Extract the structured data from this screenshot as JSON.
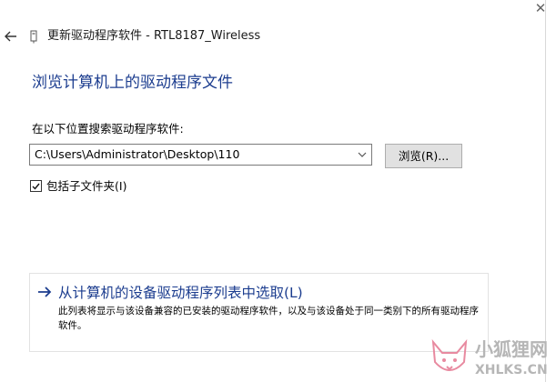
{
  "window": {
    "close_glyph": "✕",
    "title": "更新驱动程序软件 - RTL8187_Wireless",
    "back_icon": "back-arrow-icon",
    "device_icon": "device-icon"
  },
  "page": {
    "heading": "浏览计算机上的驱动程序文件",
    "search_label": "在以下位置搜索驱动程序软件:",
    "path_value": "C:\\Users\\Administrator\\Desktop\\110",
    "browse_button": "浏览(R)...",
    "include_subfolders": {
      "label": "包括子文件夹(I)",
      "checked": true
    },
    "pick_option": {
      "title": "从计算机的设备驱动程序列表中选取(L)",
      "description": "此列表将显示与该设备兼容的已安装的驱动程序软件，以及与该设备处于同一类别下的所有驱动程序软件。"
    }
  },
  "watermark": {
    "text": "小狐狸网",
    "url": "XHLKS.CN"
  },
  "colors": {
    "heading": "#1c3d8f",
    "button_bg": "#e1e1e1",
    "watermark": "#b6b6b6",
    "logo_accent": "#e88aa0"
  }
}
